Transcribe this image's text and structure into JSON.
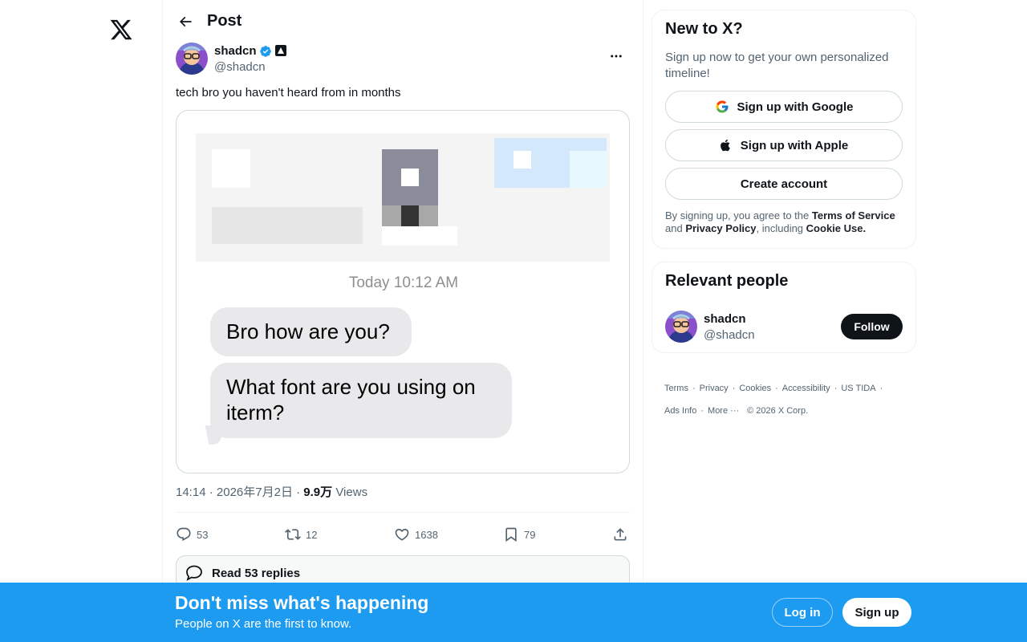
{
  "nav": {
    "logo_icon": "x-logo-icon"
  },
  "header": {
    "title": "Post",
    "back_icon": "arrow-left-icon"
  },
  "post": {
    "author": {
      "name": "shadcn",
      "handle": "@shadcn",
      "verified": true
    },
    "text": "tech bro you haven't heard from in months",
    "media": {
      "timestamp_label": "Today",
      "timestamp_time": "10:12 AM",
      "messages": [
        "Bro how are you?",
        "What font are you using on iterm?"
      ]
    },
    "meta": {
      "time": "14:14",
      "dot": "·",
      "date": "2026年7月2日",
      "views_count": "9.9万",
      "views_label": "Views"
    },
    "actions": {
      "replies": "53",
      "reposts": "12",
      "likes": "1638",
      "bookmarks": "79"
    },
    "read_replies": "Read 53 replies"
  },
  "sidebar": {
    "new_to_x": {
      "title": "New to X?",
      "subtitle": "Sign up now to get your own personalized timeline!",
      "google": "Sign up with Google",
      "apple": "Sign up with Apple",
      "create": "Create account",
      "legal_prefix": "By signing up, you agree to the",
      "terms": "Terms of Service",
      "and": "and",
      "privacy": "Privacy Policy",
      "including": ", including",
      "cookie": "Cookie Use."
    },
    "relevant": {
      "title": "Relevant people",
      "name": "shadcn",
      "handle": "@shadcn",
      "follow": "Follow"
    },
    "footer": {
      "terms": "Terms",
      "privacy": "Privacy",
      "cookies": "Cookies",
      "accessibility": "Accessibility",
      "us_tida": "US TIDA",
      "ads_info": "Ads Info",
      "more": "More ···",
      "copyright": "© 2026 X Corp."
    }
  },
  "banner": {
    "title": "Don't miss what's happening",
    "subtitle": "People on X are the first to know.",
    "login": "Log in",
    "signup": "Sign up"
  },
  "colors": {
    "accent": "#1d9bf0",
    "text": "#0f1419",
    "muted": "#536471",
    "bubble": "#e9e9eb"
  }
}
